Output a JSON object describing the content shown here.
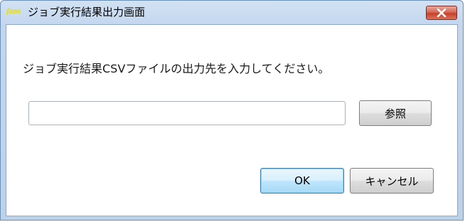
{
  "window": {
    "title": "ジョブ実行結果出力画面",
    "app_icon_text": "fam"
  },
  "dialog": {
    "prompt": "ジョブ実行結果CSVファイルの出力先を入力してください。",
    "path_value": "",
    "browse_label": "参照",
    "ok_label": "OK",
    "cancel_label": "キャンセル"
  },
  "icons": {
    "close": "close-icon",
    "app": "app-icon"
  },
  "colors": {
    "titlebar": "#c3d6ee",
    "close_button": "#c6412a",
    "default_button_border": "#3c7fb1"
  }
}
